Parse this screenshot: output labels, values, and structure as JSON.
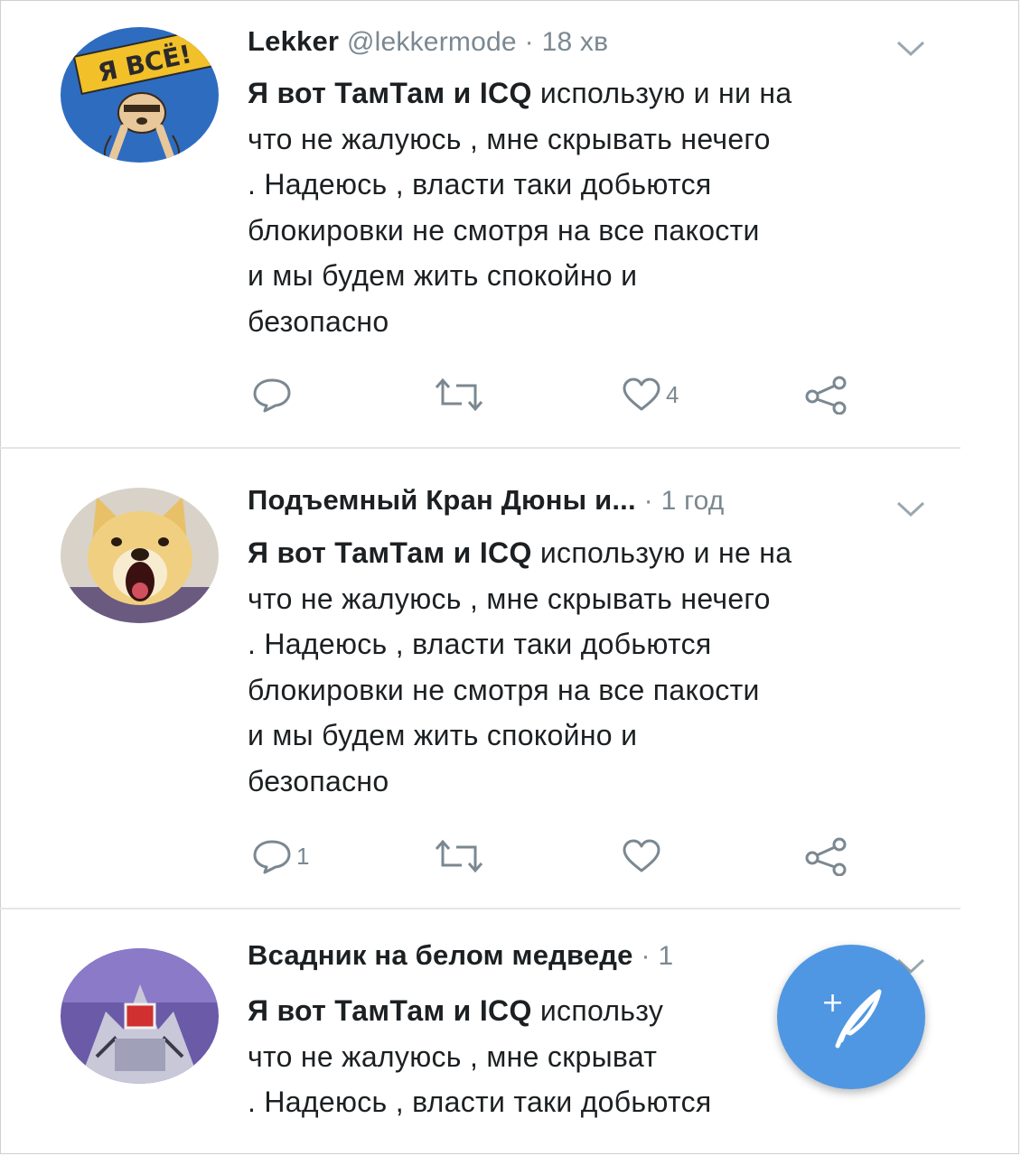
{
  "colors": {
    "text": "#1c2022",
    "secondary": "#7b8891",
    "accent": "#4f97e2",
    "divider": "#e1e6ea"
  },
  "tweets": [
    {
      "name": "Lekker",
      "handle": "@lekkermode",
      "separator": "·",
      "time": "18 хв",
      "bold_text": "Я вот ТамТам и ICQ",
      "lines": [
        "использую и ни на",
        "что не жалуюсь , мне скрывать нечего",
        ". Надеюсь , власти таки добьются",
        "блокировки не смотря на все пакости",
        "и мы будем жить спокойно и",
        "безопасно"
      ],
      "reply_count": "",
      "retweet_count": "",
      "like_count": "4",
      "avatar_icon": "sloth-avatar-icon",
      "avatar_text": "Я ВСЁ!"
    },
    {
      "name": "Подъемный Кран Дюны и...",
      "handle": "",
      "separator": "·",
      "time": "1 год",
      "bold_text": "Я вот ТамТам и ICQ",
      "lines": [
        "использую и не на",
        "что не жалуюсь , мне скрывать нечего",
        ". Надеюсь , власти таки добьются",
        "блокировки не смотря на все пакости",
        "и мы будем жить спокойно и",
        "безопасно"
      ],
      "reply_count": "1",
      "retweet_count": "",
      "like_count": "",
      "avatar_icon": "doge-avatar-icon"
    },
    {
      "name": "Всадник на белом медведе",
      "handle": "",
      "separator": "·",
      "time": "1",
      "bold_text": "Я вот ТамТам и ICQ",
      "lines": [
        "использу",
        "что не жалуюсь , мне скрыват",
        ". Надеюсь , власти таки добьются"
      ],
      "avatar_icon": "robot-avatar-icon"
    }
  ],
  "fab": {
    "icon": "compose-feather-icon",
    "plus": "+"
  }
}
